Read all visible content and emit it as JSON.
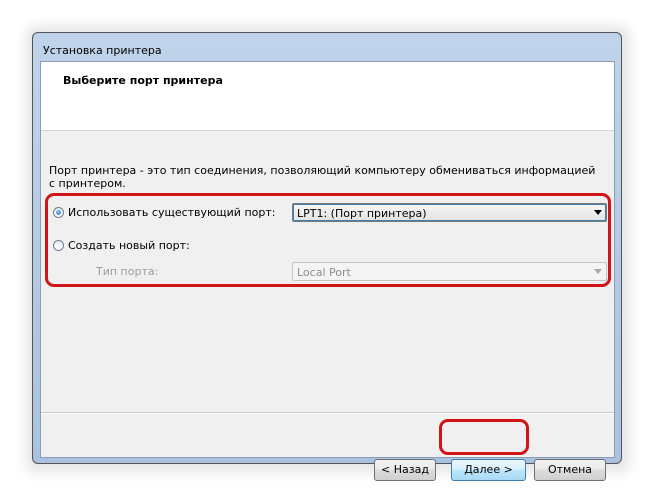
{
  "window": {
    "title": "Установка принтера"
  },
  "header": {
    "title": "Выберите порт принтера"
  },
  "description": "Порт принтера - это тип соединения, позволяющий компьютеру обмениваться информацией с принтером.",
  "options": {
    "existing_port": {
      "label": "Использовать существующий порт:",
      "selected": true,
      "dropdown_value": "LPT1: (Порт принтера)"
    },
    "new_port": {
      "label": "Создать новый порт:",
      "selected": false,
      "type_label": "Тип порта:",
      "dropdown_value": "Local Port"
    }
  },
  "buttons": {
    "back": "< Назад",
    "next": "Далее >",
    "cancel": "Отмена"
  },
  "colors": {
    "highlight": "#d01417",
    "title_bar": "#bfd4ea"
  }
}
